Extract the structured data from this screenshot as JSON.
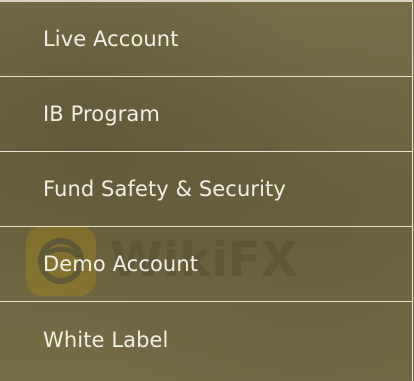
{
  "menu": {
    "items": [
      {
        "label": "Live Account"
      },
      {
        "label": "IB Program"
      },
      {
        "label": "Fund Safety & Security"
      },
      {
        "label": "Demo Account"
      },
      {
        "label": "White Label"
      }
    ]
  },
  "watermark": {
    "text": "WikiFX",
    "icon": "wikifx-logo-icon"
  },
  "colors": {
    "panel_background": "#746b45",
    "text": "#f2efe4",
    "divider": "#e6e1cc"
  }
}
